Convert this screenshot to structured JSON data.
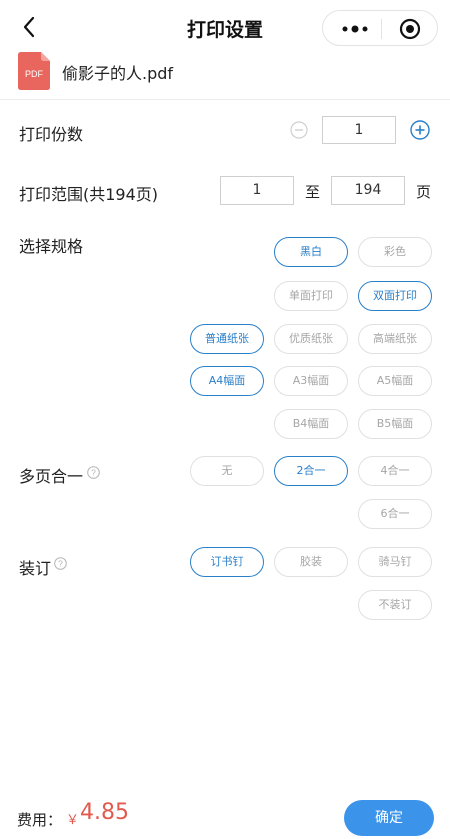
{
  "header": {
    "title": "打印设置"
  },
  "file": {
    "icon_text": "PDF",
    "name": "偷影子的人.pdf"
  },
  "copies": {
    "label": "打印份数",
    "value": "1"
  },
  "range": {
    "label": "打印范围(共194页)",
    "from": "1",
    "to_word": "至",
    "to": "194",
    "unit": "页"
  },
  "spec": {
    "label": "选择规格",
    "color_options": [
      "黑白",
      "彩色"
    ],
    "side_options": [
      "单面打印",
      "双面打印"
    ],
    "paper_options": [
      "普通纸张",
      "优质纸张",
      "高端纸张"
    ],
    "size_options": [
      "A4幅面",
      "A3幅面",
      "A5幅面",
      "B4幅面",
      "B5幅面"
    ],
    "selected": [
      "黑白",
      "双面打印",
      "普通纸张",
      "A4幅面"
    ]
  },
  "multipage": {
    "label": "多页合一",
    "options": [
      "无",
      "2合一",
      "4合一",
      "6合一"
    ],
    "selected": "2合一"
  },
  "binding": {
    "label": "装订",
    "options": [
      "订书钉",
      "胶装",
      "骑马钉",
      "不装订"
    ],
    "selected": "订书钉"
  },
  "footer": {
    "fee_label": "费用：",
    "currency": "￥",
    "amount": "4.85",
    "confirm_label": "确定"
  },
  "colors": {
    "accent": "#2a7fc9",
    "price": "#e15a4f",
    "button": "#3b93ea",
    "pdf_icon": "#e8665d"
  }
}
